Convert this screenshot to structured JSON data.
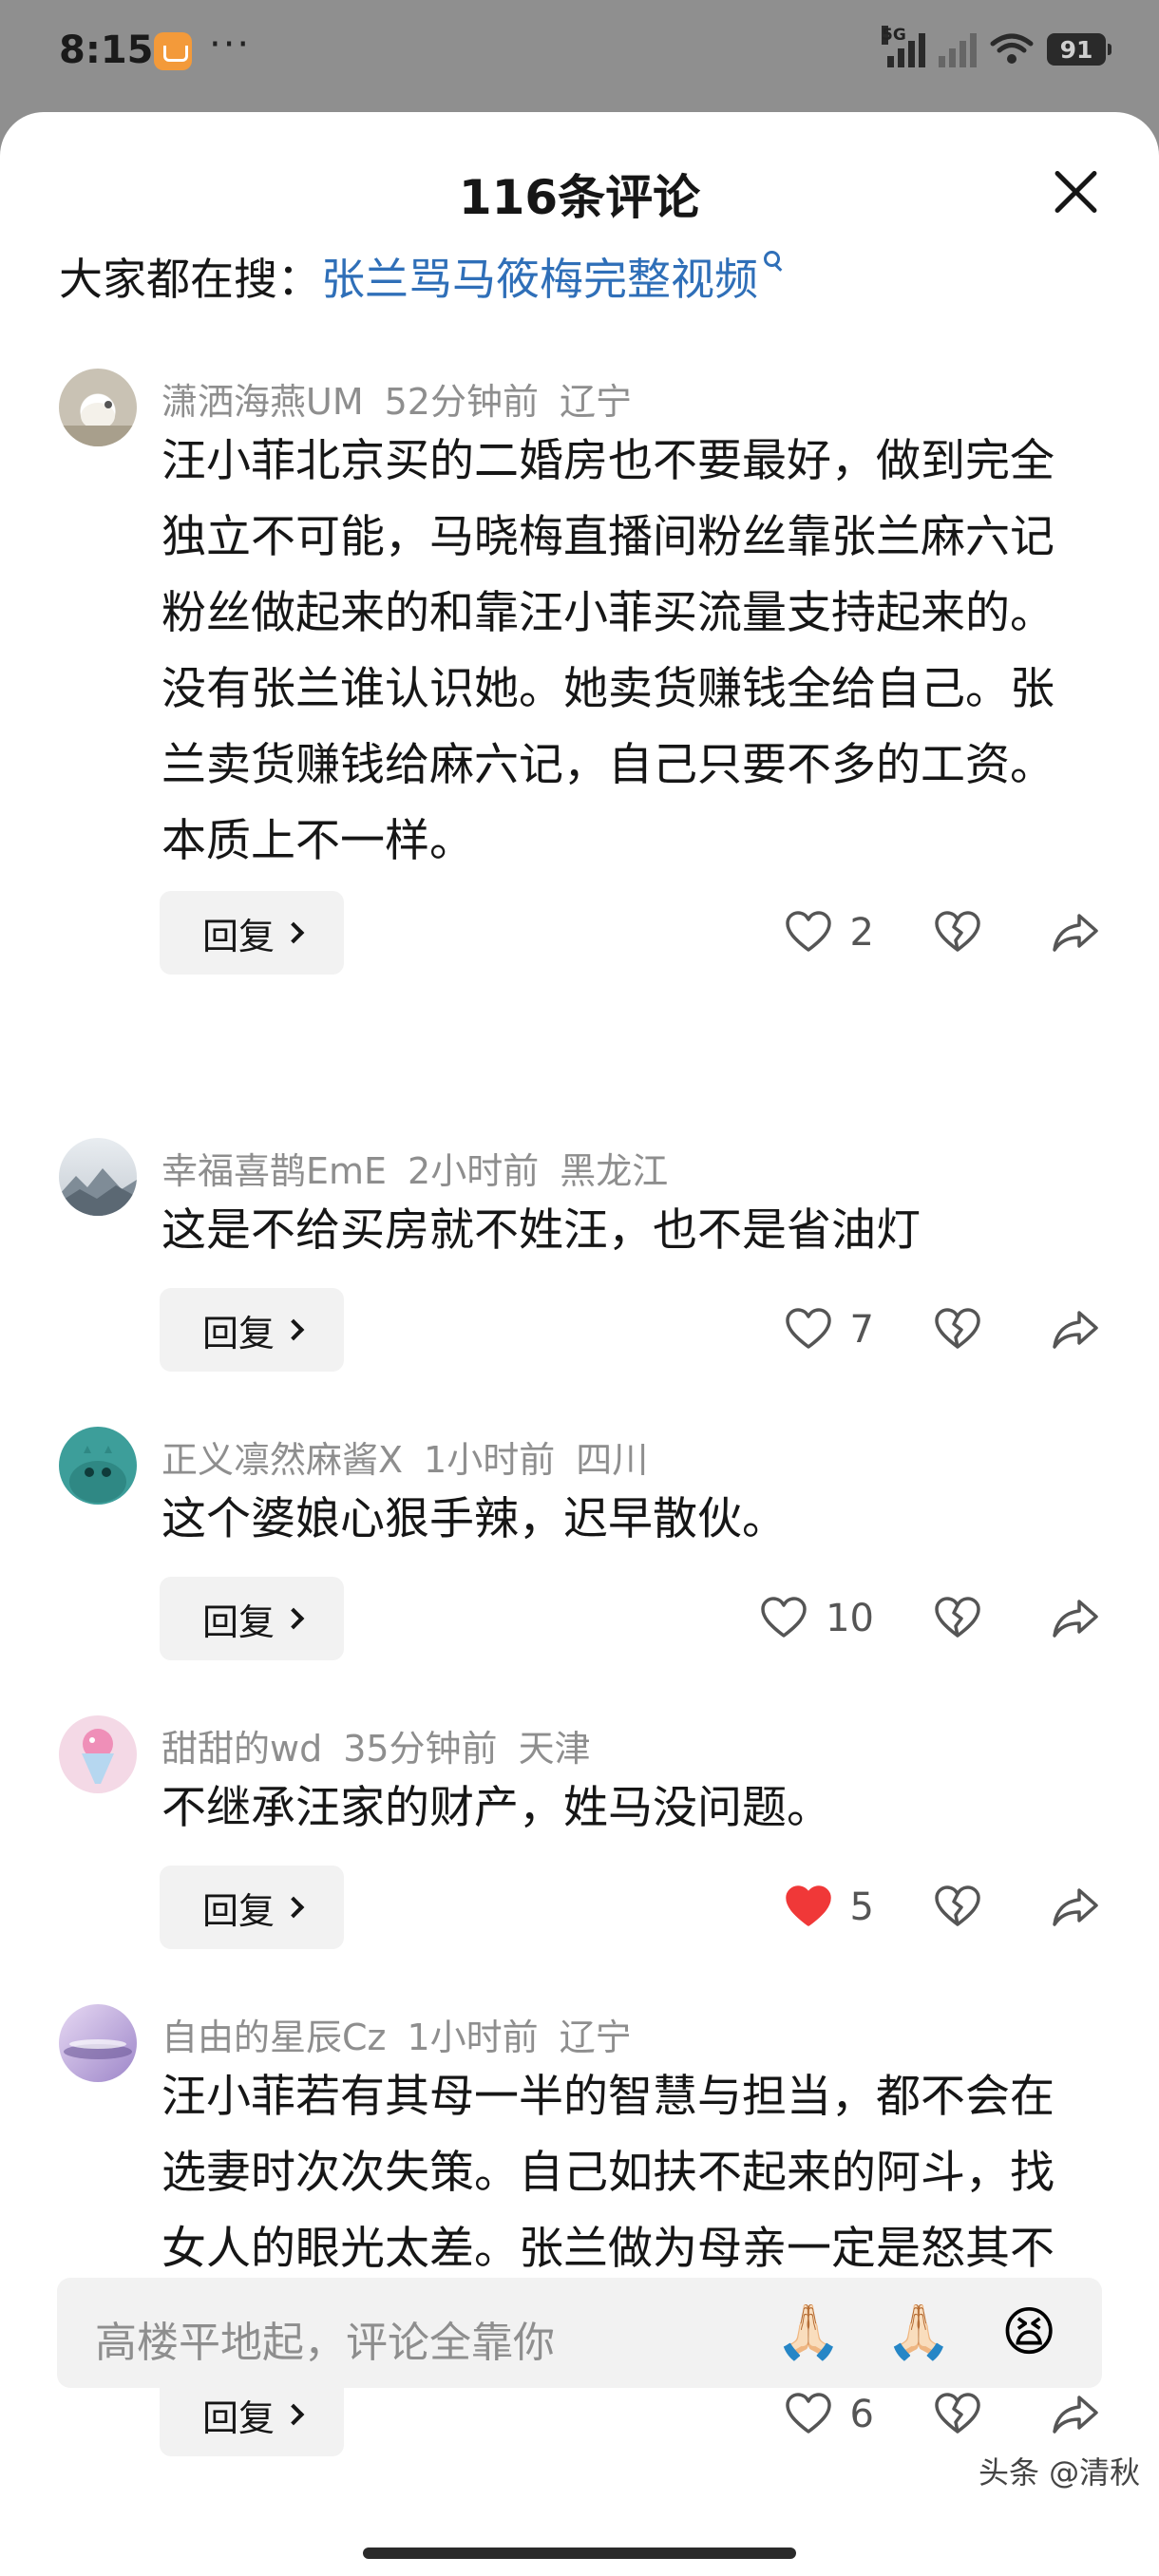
{
  "status_bar": {
    "time": "8:15",
    "dots": "···",
    "network_label": "5G",
    "battery": "91"
  },
  "sheet": {
    "title": "116条评论",
    "hot_search_prefix": "大家都在搜：",
    "hot_search_link": "张兰骂马筱梅完整视频"
  },
  "comments": [
    {
      "username": "潇洒海燕UM",
      "time": "52分钟前",
      "location": "辽宁",
      "text": "汪小菲北京买的二婚房也不要最好，做到完全独立不可能，马晓梅直播间粉丝靠张兰麻六记粉丝做起来的和靠汪小菲买流量支持起来的。没有张兰谁认识她。她卖货赚钱全给自己。张兰卖货赚钱给麻六记，自己只要不多的工资。本质上不一样。",
      "likes": "2",
      "liked": false
    },
    {
      "username": "幸福喜鹊EmE",
      "time": "2小时前",
      "location": "黑龙江",
      "text": "这是不给买房就不姓汪，也不是省油灯",
      "likes": "7",
      "liked": false
    },
    {
      "username": "正义凛然麻酱X",
      "time": "1小时前",
      "location": "四川",
      "text": "这个婆娘心狠手辣，迟早散伙。",
      "likes": "10",
      "liked": false
    },
    {
      "username": "甜甜的wd",
      "time": "35分钟前",
      "location": "天津",
      "text": "不继承汪家的财产，姓马没问题。",
      "likes": "5",
      "liked": true
    },
    {
      "username": "自由的星辰Cz",
      "time": "1小时前",
      "location": "辽宁",
      "text": "汪小菲若有其母一半的智慧与担当，都不会在选妻时次次失策。自己如扶不起来的阿斗，找女人的眼光太差。张兰做为母亲一定是怒其不争恨铁不成钢！",
      "emoji": "🤭",
      "likes": "6",
      "liked": false
    }
  ],
  "reply_label": "回复",
  "input": {
    "placeholder": "高楼平地起，评论全靠你",
    "emojis": [
      "🙏🏻",
      "🙏🏻",
      "😫"
    ]
  },
  "watermark": "头条 @清秋",
  "colors": {
    "link": "#2f6fb8",
    "like_active": "#f03838",
    "meta_gray": "#8e8e8e"
  }
}
